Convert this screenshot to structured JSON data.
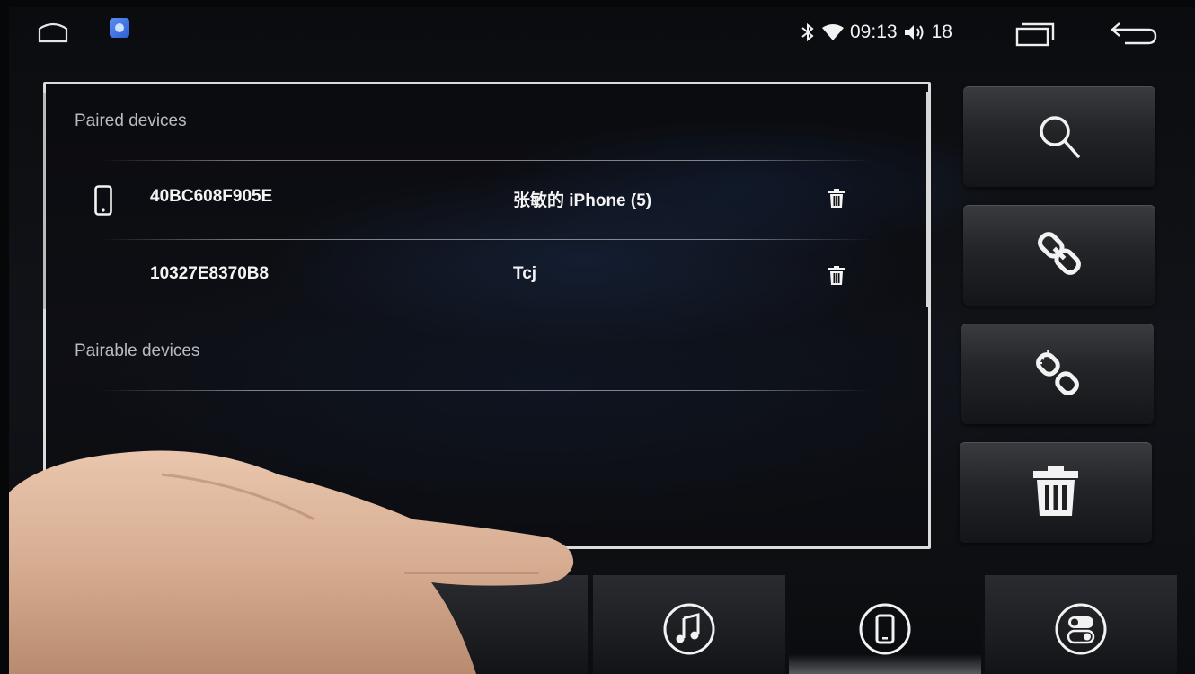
{
  "status_bar": {
    "time": "09:13",
    "volume": "18",
    "icons": [
      "home-icon",
      "app-launcher-icon",
      "bluetooth-icon",
      "wifi-icon",
      "volume-icon",
      "recent-apps-icon",
      "back-icon"
    ]
  },
  "paired_section": {
    "title": "Paired devices",
    "devices": [
      {
        "address": "40BC608F905E",
        "name": "张敏的 iPhone (5)",
        "connected": true
      },
      {
        "address": "10327E8370B8",
        "name": "Tcj",
        "connected": false
      }
    ]
  },
  "pairable_section": {
    "title": "Pairable devices",
    "devices": []
  },
  "side_actions": [
    "search-icon",
    "link-icon",
    "unlink-icon",
    "trash-icon"
  ],
  "bottom_tabs": [
    {
      "icon": "",
      "active": false
    },
    {
      "icon": "music-icon",
      "active": false
    },
    {
      "icon": "phone-icon",
      "active": true
    },
    {
      "icon": "toggle-settings-icon",
      "active": false
    }
  ],
  "colors": {
    "background": "#0c0d10",
    "panel_border": "#dcdcdc",
    "accent_blue": "#2d5fd6",
    "text": "#f4f4f4",
    "section_title": "#b8bcc2"
  }
}
